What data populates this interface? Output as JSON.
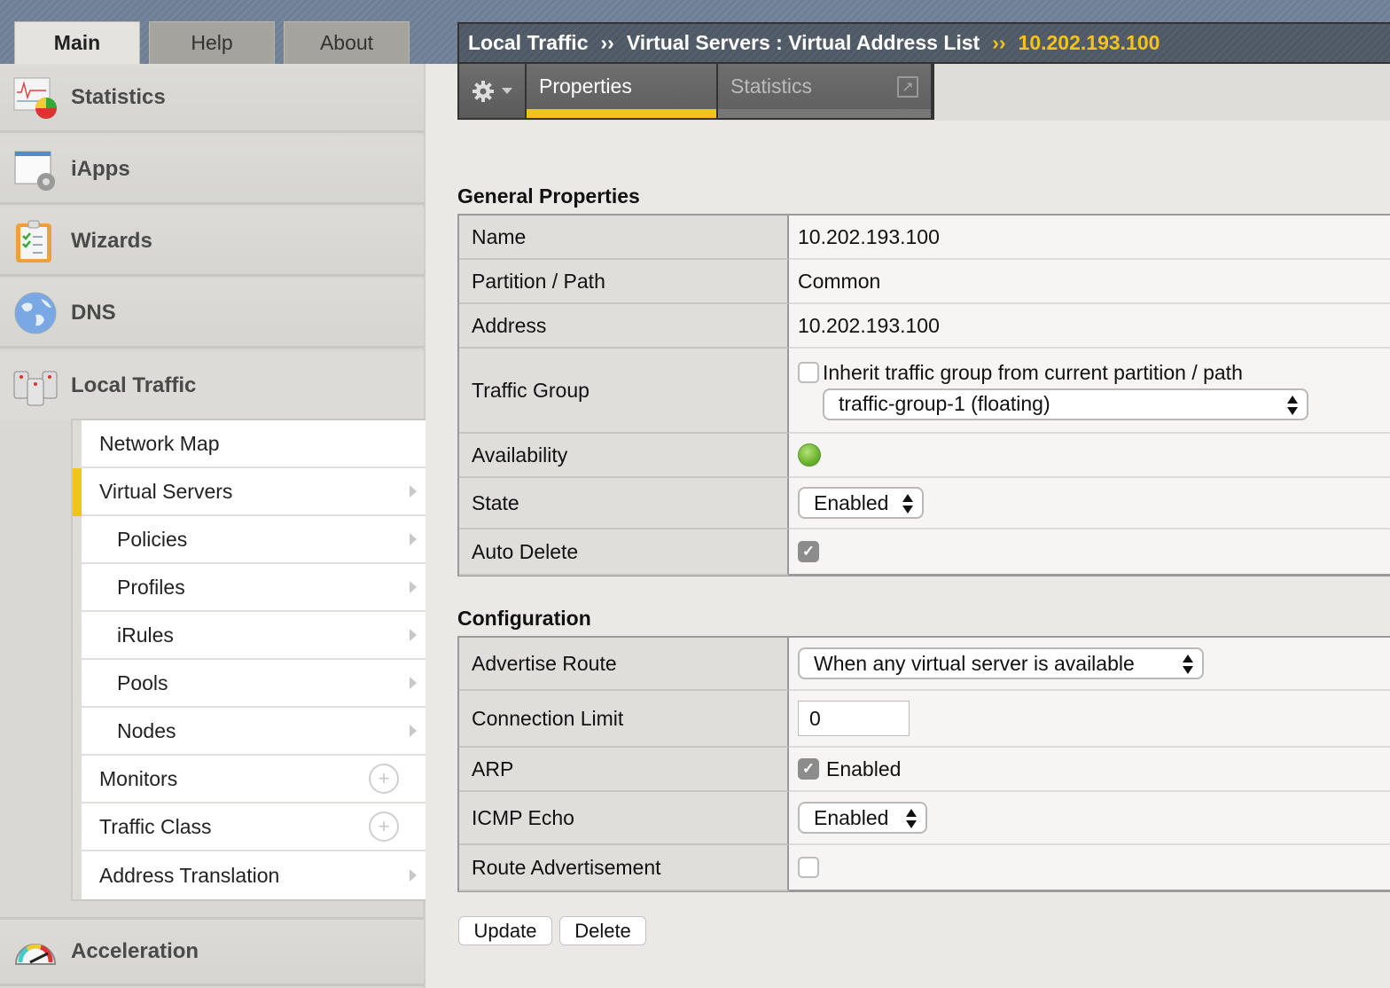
{
  "main_tabs": [
    {
      "label": "Main",
      "active": true
    },
    {
      "label": "Help",
      "active": false
    },
    {
      "label": "About",
      "active": false
    }
  ],
  "sidebar": {
    "categories": [
      {
        "label": "Statistics",
        "icon": "statistics-icon"
      },
      {
        "label": "iApps",
        "icon": "iapps-icon"
      },
      {
        "label": "Wizards",
        "icon": "wizards-icon"
      },
      {
        "label": "DNS",
        "icon": "dns-globe-icon"
      },
      {
        "label": "Local Traffic",
        "icon": "local-traffic-icon"
      },
      {
        "label": "Acceleration",
        "icon": "acceleration-gauge-icon"
      }
    ],
    "local_traffic_items": [
      {
        "label": "Network Map",
        "indent": false,
        "active": false,
        "affordance": "none"
      },
      {
        "label": "Virtual Servers",
        "indent": false,
        "active": true,
        "affordance": "arrow"
      },
      {
        "label": "Policies",
        "indent": true,
        "active": false,
        "affordance": "arrow"
      },
      {
        "label": "Profiles",
        "indent": true,
        "active": false,
        "affordance": "arrow"
      },
      {
        "label": "iRules",
        "indent": true,
        "active": false,
        "affordance": "arrow"
      },
      {
        "label": "Pools",
        "indent": true,
        "active": false,
        "affordance": "arrow"
      },
      {
        "label": "Nodes",
        "indent": true,
        "active": false,
        "affordance": "arrow"
      },
      {
        "label": "Monitors",
        "indent": false,
        "active": false,
        "affordance": "plus"
      },
      {
        "label": "Traffic Class",
        "indent": false,
        "active": false,
        "affordance": "plus"
      },
      {
        "label": "Address Translation",
        "indent": false,
        "active": false,
        "affordance": "arrow"
      }
    ],
    "plus_glyph": "+"
  },
  "breadcrumb": {
    "parts": [
      "Local Traffic",
      "Virtual Servers : Virtual Address List"
    ],
    "separator": "››",
    "current": "10.202.193.100"
  },
  "content_tabs": [
    {
      "label": "Properties",
      "active": true
    },
    {
      "label": "Statistics",
      "active": false
    }
  ],
  "popout_glyph": "↗",
  "general_properties": {
    "title": "General Properties",
    "name_label": "Name",
    "name_value": "10.202.193.100",
    "partition_label": "Partition / Path",
    "partition_value": "Common",
    "address_label": "Address",
    "address_value": "10.202.193.100",
    "traffic_group_label": "Traffic Group",
    "inherit_label": "Inherit traffic group from current partition / path",
    "inherit_checked": false,
    "traffic_group_value": "traffic-group-1 (floating)",
    "availability_label": "Availability",
    "availability_status": "available",
    "availability_color": "#6bb32e",
    "state_label": "State",
    "state_value": "Enabled",
    "auto_delete_label": "Auto Delete",
    "auto_delete_checked": true
  },
  "configuration": {
    "title": "Configuration",
    "advertise_route_label": "Advertise Route",
    "advertise_route_value": "When any virtual server is available",
    "connection_limit_label": "Connection Limit",
    "connection_limit_value": "0",
    "arp_label": "ARP",
    "arp_checked": true,
    "arp_text": "Enabled",
    "icmp_label": "ICMP Echo",
    "icmp_value": "Enabled",
    "route_adv_label": "Route Advertisement",
    "route_adv_checked": false
  },
  "check_glyph": "✓",
  "buttons": {
    "update": "Update",
    "delete": "Delete"
  },
  "colors": {
    "accent": "#f4c21c",
    "banner": "#76869a",
    "crumb_bg": "#555f6b"
  }
}
